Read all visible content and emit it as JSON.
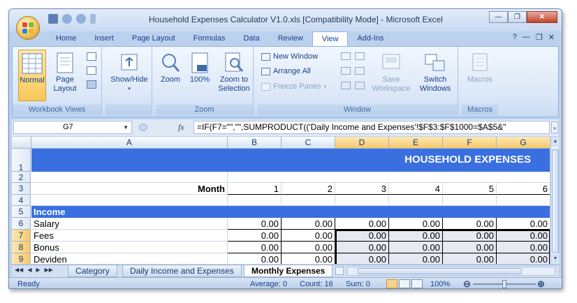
{
  "window": {
    "title": "Household Expenses Calculator V1.0.xls  [Compatibility Mode] - Microsoft Excel",
    "minimize": "—",
    "restore": "❐",
    "close": "✕"
  },
  "tabs": [
    "Home",
    "Insert",
    "Page Layout",
    "Formulas",
    "Data",
    "Review",
    "View",
    "Add-Ins"
  ],
  "active_tab": "View",
  "ribbon": {
    "workbook_views": {
      "label": "Workbook Views",
      "normal": "Normal",
      "page_layout": "Page Layout"
    },
    "show_hide": {
      "label": "Show/Hide"
    },
    "zoom": {
      "label": "Zoom",
      "zoom": "Zoom",
      "zoom100": "100%",
      "zoom_to_selection": "Zoom to Selection"
    },
    "window": {
      "label": "Window",
      "new_window": "New Window",
      "arrange_all": "Arrange All",
      "freeze_panes": "Freeze Panes",
      "save_workspace": "Save Workspace",
      "switch_windows": "Switch Windows"
    },
    "macros": {
      "label": "Macros",
      "macros": "Macros"
    }
  },
  "formula_bar": {
    "name_box": "G7",
    "fx": "fx",
    "formula": "=IF(F7=\"\",\"\",SUMPRODUCT(('Daily Income and Expenses'!$F$3:$F$1000=$A$5&\""
  },
  "grid": {
    "columns": [
      "A",
      "B",
      "C",
      "D",
      "E",
      "F",
      "G"
    ],
    "rows": [
      "1",
      "2",
      "3",
      "4",
      "5",
      "6",
      "7",
      "8",
      "9"
    ],
    "banner": "HOUSEHOLD EXPENSES",
    "month_label": "Month",
    "months": [
      "1",
      "2",
      "3",
      "4",
      "5",
      "6"
    ],
    "income_label": "Income",
    "items": [
      {
        "label": "Salary",
        "values": [
          "0.00",
          "0.00",
          "0.00",
          "0.00",
          "0.00",
          "0.00"
        ]
      },
      {
        "label": "Fees",
        "values": [
          "0.00",
          "0.00",
          "0.00",
          "0.00",
          "0.00",
          "0.00"
        ]
      },
      {
        "label": "Bonus",
        "values": [
          "0.00",
          "0.00",
          "0.00",
          "0.00",
          "0.00",
          "0.00"
        ]
      },
      {
        "label": "Deviden",
        "values": [
          "0.00",
          "0.00",
          "0.00",
          "0.00",
          "0.00",
          "0.00"
        ]
      }
    ]
  },
  "sheets": [
    "Category",
    "Daily Income and Expenses",
    "Monthly Expenses"
  ],
  "active_sheet": "Monthly Expenses",
  "status": {
    "ready": "Ready",
    "average": "Average: 0",
    "count": "Count: 16",
    "sum": "Sum: 0",
    "zoom": "100%",
    "zoom_fraction": 0.5
  },
  "colors": {
    "accent": "#3a6fe0",
    "selection": "#f6c86a",
    "ribbon": "#dbe7f7"
  }
}
